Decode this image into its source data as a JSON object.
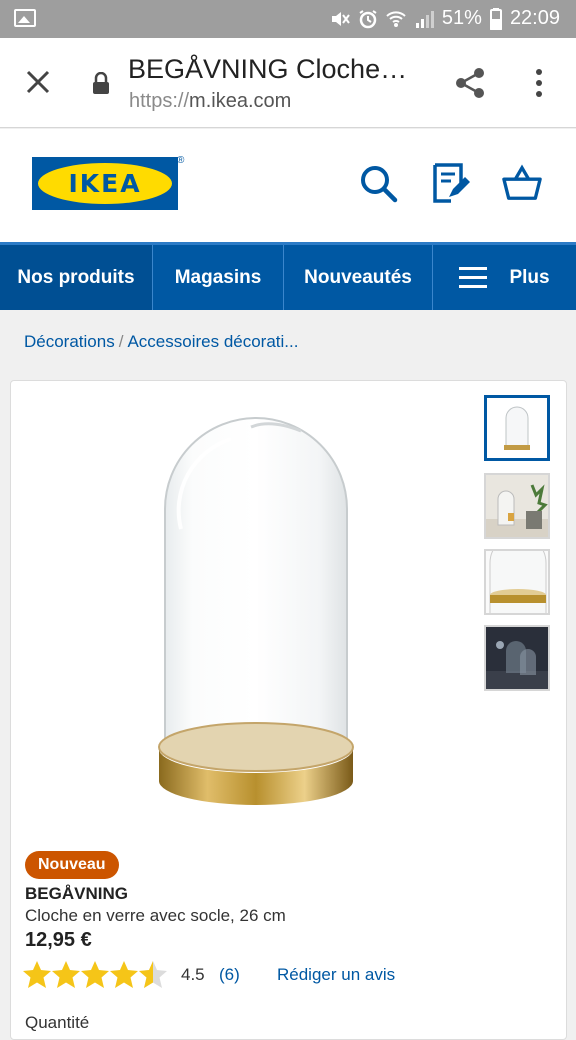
{
  "status_bar": {
    "battery": "51%",
    "time": "22:09"
  },
  "url_bar": {
    "title": "BEGÅVNING Cloche…",
    "url_protocol": "https://",
    "url_host": "m.ikea.com"
  },
  "brand": {
    "logo_text": "IKEA",
    "registered": "®"
  },
  "nav": {
    "items": [
      {
        "label": "Nos produits"
      },
      {
        "label": "Magasins"
      },
      {
        "label": "Nouveautés"
      },
      {
        "label": "Plus"
      }
    ]
  },
  "breadcrumb": {
    "items": [
      "Décorations",
      "Accessoires décorati..."
    ],
    "separator": "/"
  },
  "product": {
    "badge": "Nouveau",
    "name": "BEGÅVNING",
    "description": "Cloche en verre avec socle, 26 cm",
    "price": "12,95 €",
    "rating": {
      "value": "4.5",
      "count": "(6)",
      "stars": 4.5,
      "max": 5
    },
    "review_link": "Rédiger un avis",
    "quantity_label": "Quantité",
    "thumbnails_count": 4,
    "selected_thumbnail": 1
  },
  "colors": {
    "ikea_blue": "#0058a3",
    "ikea_yellow": "#ffdb00",
    "badge_orange": "#cc5500",
    "star_yellow": "#f5c518",
    "gold": "#b8902e"
  },
  "icons": [
    "gallery-icon",
    "mute-icon",
    "alarm-icon",
    "wifi-icon",
    "signal-icon",
    "battery-icon",
    "close-icon",
    "lock-icon",
    "share-icon",
    "more-vert-icon",
    "search-icon",
    "shopping-list-icon",
    "basket-icon",
    "menu-icon",
    "star-icon"
  ]
}
